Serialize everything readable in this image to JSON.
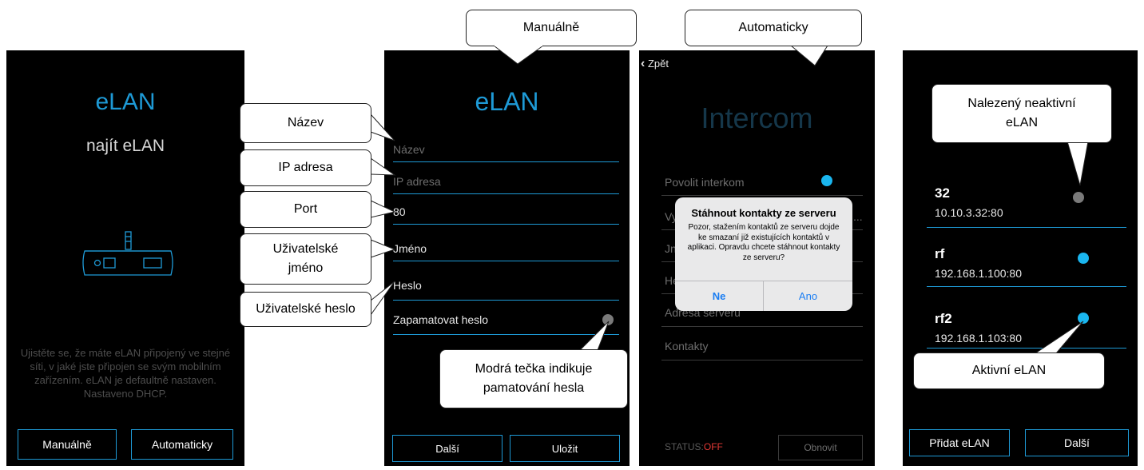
{
  "screen1": {
    "title": "eLAN",
    "subtitle": "najít eLAN",
    "info": "Ujistěte se, že máte eLAN připojený ve stejné síti, v jaké jste připojen se svým mobilním zařízením. eLAN je defaultně nastaven.\nNastaveno DHCP.",
    "btn_manual": "Manuálně",
    "btn_auto": "Automaticky",
    "icon": "elan-device-icon"
  },
  "screen2": {
    "title": "eLAN",
    "name_placeholder": "Název",
    "ip_placeholder": "IP adresa",
    "port_value": "80",
    "username": "Jméno",
    "password": "Heslo",
    "remember_label": "Zapamatovat heslo",
    "btn_next": "Další",
    "btn_save": "Uložit"
  },
  "screen3": {
    "back_label": "Zpět",
    "title": "Intercom",
    "row_enable": "Povolit interkom",
    "row_v": "Vy",
    "row_j": "Jn",
    "row_h": "He",
    "row_address": "Adresa serveru",
    "row_contacts": "Kontakty",
    "status_label": "STATUS:",
    "status_value": "OFF",
    "btn_refresh": "Obnovit",
    "dialog": {
      "title": "Stáhnout kontakty ze serveru",
      "message": "Pozor, stažením kontaktů ze serveru dojde ke smazaní již existujících kontaktů v aplikaci. Opravdu chcete stáhnout kontakty ze serveru?",
      "btn_no": "Ne",
      "btn_yes": "Ano"
    }
  },
  "screen4": {
    "items": [
      {
        "name": "32",
        "address": "10.10.3.32:80",
        "active": false
      },
      {
        "name": "rf",
        "address": "192.168.1.100:80",
        "active": true
      },
      {
        "name": "rf2",
        "address": "192.168.1.103:80",
        "active": true
      }
    ],
    "btn_add": "Přidat eLAN",
    "btn_next": "Další"
  },
  "callouts": {
    "manual": "Manuálně",
    "auto": "Automaticky",
    "name": "Název",
    "ip": "IP adresa",
    "port": "Port",
    "username": "Uživatelské jméno",
    "password": "Uživatelské heslo",
    "blue_dot": "Modrá tečka indikuje pamatování hesla",
    "inactive": "Nalezený neaktivní eLAN",
    "active": "Aktivní eLAN"
  },
  "colors": {
    "accent": "#1e9ad6",
    "dot_active": "#1ab6ef",
    "dot_inactive": "#7a7a7a",
    "status_off": "#e53935",
    "dialog_bg": "#e9e9ea",
    "dialog_button": "#1a7df2"
  }
}
